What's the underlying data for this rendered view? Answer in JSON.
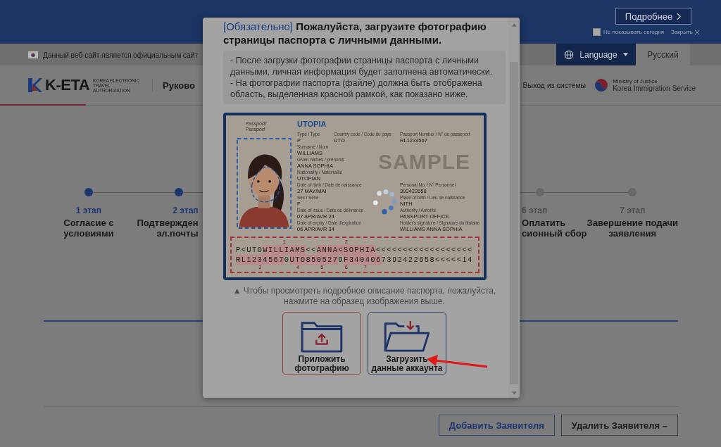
{
  "banner": {
    "more_button": "Подробнее",
    "dont_show_today": {
      "label": "Не показывать сегодня",
      "checked": false
    },
    "close_link": "Закрыть"
  },
  "info_bar": {
    "notice": "Данный веб-сайт является официальным сайт",
    "language_button": "Language",
    "current_language": "Русский"
  },
  "header": {
    "logo_text": "K-ETA",
    "logo_subtitle": "KOREA ELECTRONIC TRAVEL AUTHORIZATION",
    "nav_item": "Руково",
    "logout_link": "Выход из системы",
    "ministry_name": "Ministry of Justice",
    "service_name": "Korea Immigration Service"
  },
  "steps": [
    {
      "number": "1 этап",
      "lines": [
        "Согласие с",
        "условиями"
      ],
      "active": true
    },
    {
      "number": "2 этап",
      "lines": [
        "Подтвержден",
        "эл.почты"
      ],
      "active": true
    },
    {
      "number": "6 этап",
      "lines": [
        "Оплатить",
        "сионный сбор"
      ],
      "active": false
    },
    {
      "number": "7 этап",
      "lines": [
        "Завершение подачи",
        "заявления"
      ],
      "active": false
    }
  ],
  "applicant_buttons": [
    {
      "label": "Добавить Заявителя",
      "kind": "add"
    },
    {
      "label": "Удалить Заявителя –",
      "kind": "remove"
    }
  ],
  "modal": {
    "title_tag": "[Обязательно]",
    "title": "Пожалуйста, загрузите фотографию страницы паспорта с личными данными.",
    "notes": [
      "- После загрузки фотографии страницы паспорта с личными данными, личная информация будет заполнена автоматически.",
      "- На фотографии паспорта (файле) должна быть отображена область, выделенная красной рамкой, как показано ниже."
    ],
    "passport": {
      "doc_label": "Passport/ Passport",
      "country": "UTOPIA",
      "watermark_text": "SAMPLE",
      "rows": [
        [
          {
            "label": "Type / Type",
            "value": "P"
          },
          {
            "label": "Country code / Code du pays",
            "value": "UTO"
          },
          {
            "label": "Passport Number / N° de passeport",
            "value": "RL1234567"
          }
        ],
        [
          {
            "label": "Surname / Nom",
            "value": "WILLIAMS"
          }
        ],
        [
          {
            "label": "Given names / prénoms",
            "value": "ANNA SOPHIA"
          }
        ],
        [
          {
            "label": "Nationality / Nationalité",
            "value": "UTOPIAN"
          }
        ],
        [
          {
            "label": "Date of birth / Date de naissance",
            "value": "27 MAY/MAI"
          },
          {
            "label": "Personal No. / N° Personnel",
            "value": "392422658"
          }
        ],
        [
          {
            "label": "Sex / Sexe",
            "value": "F"
          },
          {
            "label": "Place of birth / Lieu de naissance",
            "value": "NITH"
          }
        ],
        [
          {
            "label": "Date of issue / Date de délivrance",
            "value": "07 APR/AVR 24"
          },
          {
            "label": "Authority / Autorité",
            "value": "PASSPORT OFFICE"
          }
        ],
        [
          {
            "label": "Date of expiry / Date d'expiration",
            "value": "06 APR/AVR 34"
          },
          {
            "label": "Holder's signature / Signature du titulaire",
            "value": "WILLIAMS ANNA SOPHIA"
          }
        ]
      ],
      "mrz": [
        [
          {
            "text": "P<UTO",
            "highlighted": false
          },
          {
            "text": "WILLIAMS",
            "highlighted": true,
            "marker": "1"
          },
          {
            "text": "<<",
            "highlighted": false
          },
          {
            "text": "ANNA<SOPHIA",
            "highlighted": true,
            "marker": "2"
          },
          {
            "text": "<<<<<<<<<<<<<<<<<<",
            "highlighted": false
          }
        ],
        [
          {
            "text": "RL1234567",
            "highlighted": true,
            "marker": "3"
          },
          {
            "text": "0",
            "highlighted": false
          },
          {
            "text": "UTO",
            "highlighted": true,
            "marker": "4"
          },
          {
            "text": "850527",
            "highlighted": true,
            "marker": "5"
          },
          {
            "text": "9",
            "highlighted": false
          },
          {
            "text": "F",
            "highlighted": true,
            "marker": "6"
          },
          {
            "text": "340406",
            "highlighted": true,
            "marker": "7"
          },
          {
            "text": "7392422658<<<<<14",
            "highlighted": false
          }
        ]
      ]
    },
    "caption": "▲ Чтобы просмотреть подробное описание паспорта, пожалуйста, нажмите на образец изображения выше.",
    "options": [
      {
        "label": "Приложить фотографию",
        "kind": "attach"
      },
      {
        "label": "Загрузить данные аккаунта",
        "kind": "load"
      }
    ]
  }
}
